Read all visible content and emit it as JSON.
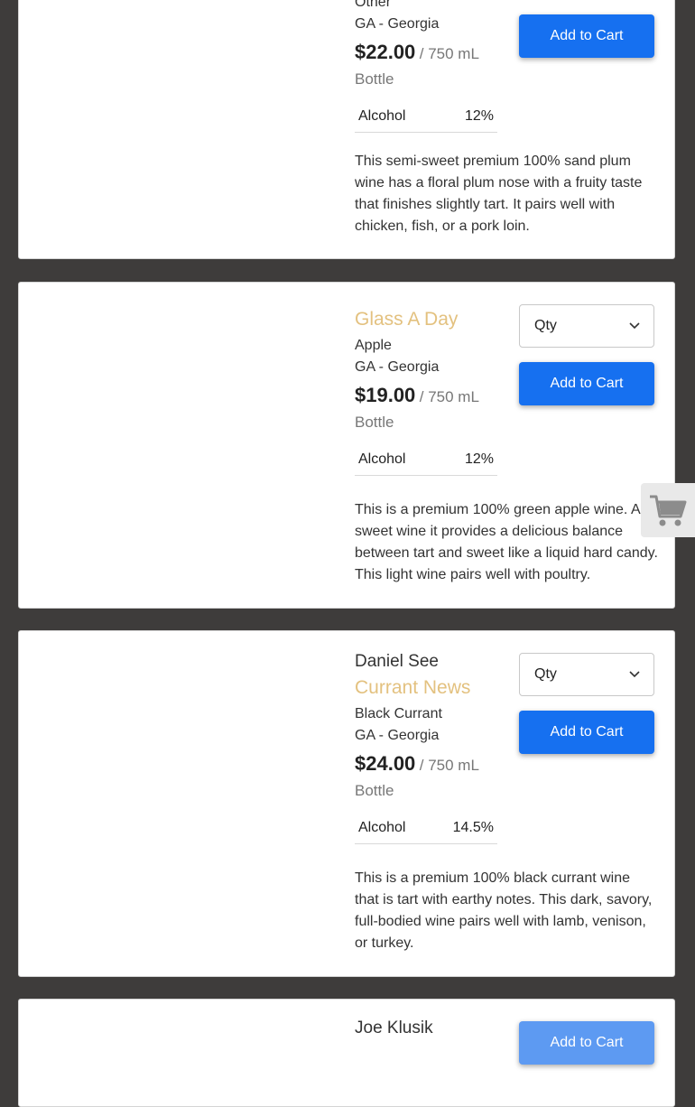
{
  "common": {
    "add_to_cart": "Add to Cart",
    "qty_placeholder": "Qty",
    "per_unit": "/ 750 mL",
    "bottle": "Bottle",
    "alcohol_label": "Alcohol"
  },
  "colors": {
    "page_background": "#3e3c3b",
    "title_gold": "#e3c17f",
    "button_blue": "#1670f0"
  },
  "products": [
    {
      "winery": "Other",
      "fruit": "",
      "region": "GA - Georgia",
      "price": "$22.00",
      "alcohol": "12%",
      "description": "This semi-sweet premium 100% sand plum wine has a floral plum nose with a fruity taste that finishes slightly tart. It pairs well with chicken, fish, or a pork loin."
    },
    {
      "title": "Glass A Day",
      "fruit": "Apple",
      "region": "GA - Georgia",
      "price": "$19.00",
      "alcohol": "12%",
      "description": "This is a premium 100% green apple wine. As sweet wine it provides a delicious balance between tart and sweet like a liquid hard candy. This light wine pairs well with poultry."
    },
    {
      "winery": "Daniel See",
      "title": "Currant News",
      "fruit": "Black Currant",
      "region": "GA - Georgia",
      "price": "$24.00",
      "alcohol": "14.5%",
      "description": "This is a premium 100% black currant wine that is tart with earthy notes. This dark, savory, full-bodied wine pairs well with lamb, venison, or turkey."
    },
    {
      "winery": "Joe Klusik"
    }
  ],
  "floating_cart_icon": "shopping-cart-icon"
}
